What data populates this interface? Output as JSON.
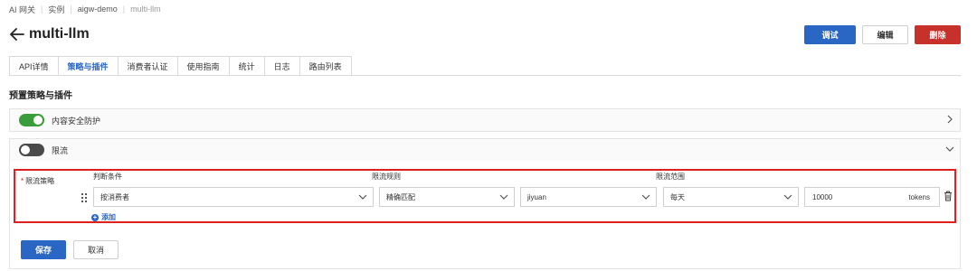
{
  "breadcrumb": [
    "AI 网关",
    "实例",
    "aigw-demo",
    "multi-llm"
  ],
  "page": {
    "title": "multi-llm"
  },
  "actions": {
    "debug": "调试",
    "edit": "编辑",
    "delete": "删除"
  },
  "tabs": [
    {
      "label": "API详情",
      "active": false
    },
    {
      "label": "策略与插件",
      "active": true
    },
    {
      "label": "消费者认证",
      "active": false
    },
    {
      "label": "使用指南",
      "active": false
    },
    {
      "label": "统计",
      "active": false
    },
    {
      "label": "日志",
      "active": false
    },
    {
      "label": "路由列表",
      "active": false
    }
  ],
  "section": {
    "title": "预置策略与插件"
  },
  "plugins": [
    {
      "label": "内容安全防护",
      "enabled": true,
      "expanded": false
    },
    {
      "label": "限流",
      "enabled": false,
      "expanded": true
    }
  ],
  "rate_limit": {
    "required_mark": "*",
    "policy_label": "限流策略",
    "headers": {
      "condition": "判断条件",
      "rule": "限流规则",
      "scope": "限流范围"
    },
    "rule": {
      "condition": "按消费者",
      "match": "精确匹配",
      "consumer": "jiyuan",
      "period": "每天",
      "limit": "10000",
      "unit": "tokens"
    },
    "add_label": "添加",
    "add_icon": "+"
  },
  "form": {
    "save": "保存",
    "cancel": "取消"
  },
  "colors": {
    "primary": "#2a66c4",
    "danger": "#c8302b",
    "toggle_on": "#3a9c3a",
    "highlight": "#e02020"
  }
}
